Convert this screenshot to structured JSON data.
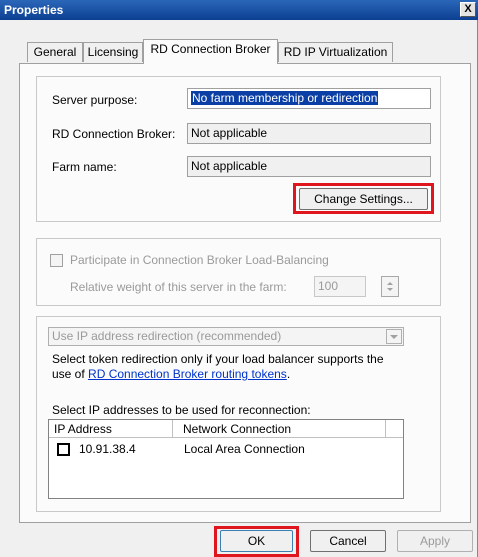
{
  "window": {
    "title": "Properties",
    "close_glyph": "X"
  },
  "tabs": [
    {
      "label": "General",
      "active": false
    },
    {
      "label": "Licensing",
      "active": false
    },
    {
      "label": "RD Connection Broker",
      "active": true
    },
    {
      "label": "RD IP Virtualization",
      "active": false
    }
  ],
  "broker": {
    "server_purpose_label": "Server purpose:",
    "server_purpose_value": "No farm membership or redirection",
    "rd_broker_label": "RD Connection Broker:",
    "rd_broker_value": "Not applicable",
    "farm_name_label": "Farm name:",
    "farm_name_value": "Not applicable",
    "change_settings_label": "Change Settings..."
  },
  "load_balancing": {
    "participate_label": "Participate in Connection Broker Load-Balancing",
    "weight_label": "Relative weight of this server in the farm:",
    "weight_value": "100"
  },
  "redirection": {
    "dropdown_value": "Use IP address redirection (recommended)",
    "description_line1": "Select token redirection only if your load balancer supports the",
    "description_line2_prefix": "use of ",
    "routing_tokens_link": "RD Connection Broker routing tokens",
    "description_line2_suffix": ".",
    "ip_select_label": "Select IP addresses to be used for reconnection:",
    "columns": [
      "IP Address",
      "Network Connection"
    ],
    "rows": [
      {
        "ip": "10.91.38.4",
        "connection": "Local Area Connection",
        "checked": false
      }
    ]
  },
  "footer": {
    "ok_label": "OK",
    "cancel_label": "Cancel",
    "apply_label": "Apply"
  },
  "colors": {
    "highlight": "#e0161e",
    "titlebar": "#1c56a6",
    "link": "#0033cc"
  }
}
